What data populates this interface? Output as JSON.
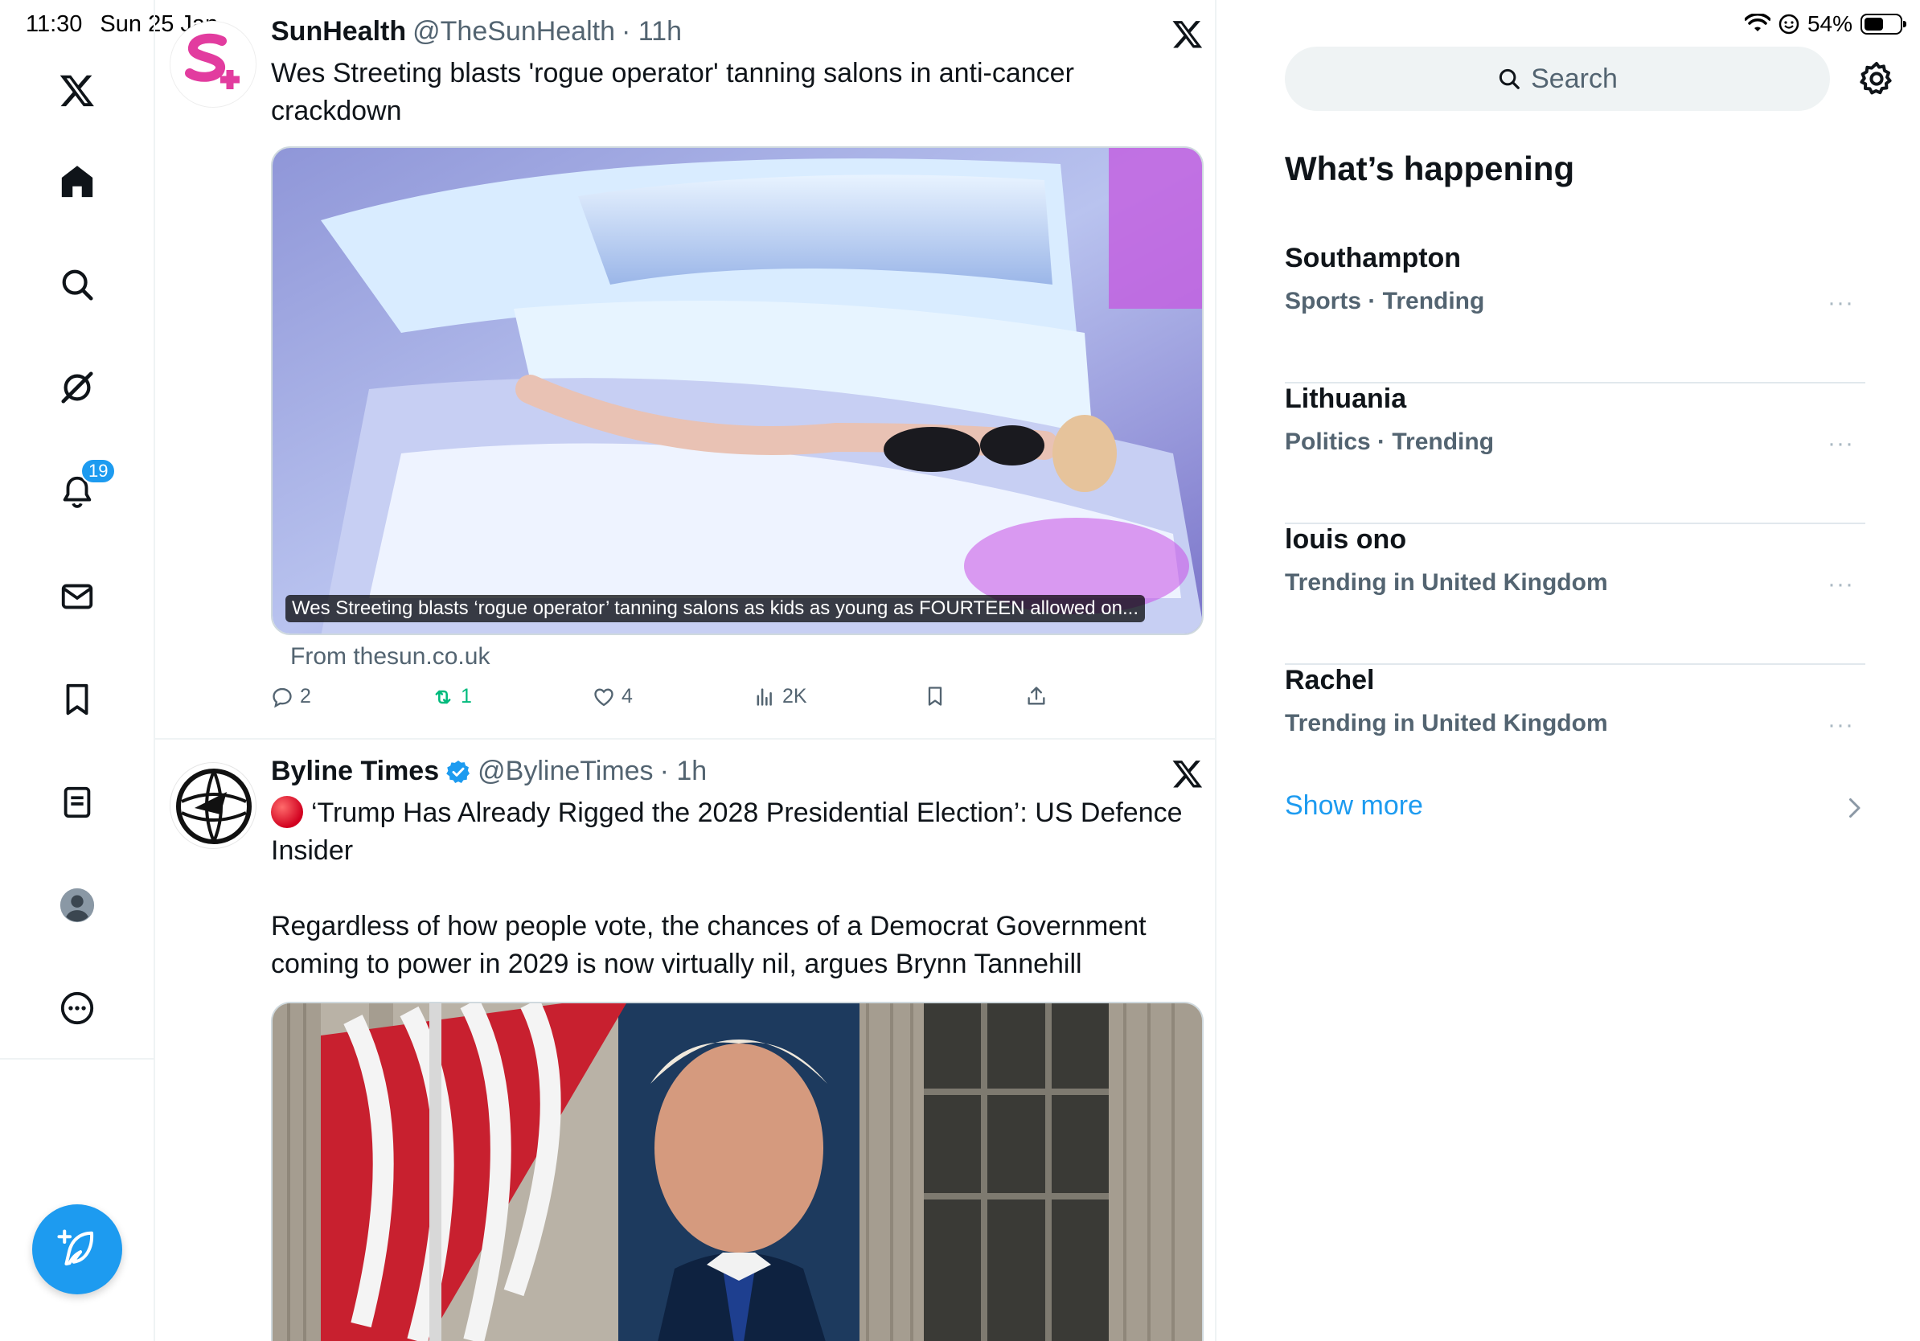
{
  "status_bar": {
    "time": "11:30",
    "date": "Sun 25 Jan",
    "battery": "54%",
    "battery_level": 0.54
  },
  "nav": {
    "notifications_badge": "19",
    "items": [
      "x-logo-icon",
      "home-icon",
      "search-icon",
      "grok-icon",
      "notifications-icon",
      "messages-icon",
      "bookmarks-icon",
      "lists-icon",
      "profile-icon",
      "more-icon"
    ]
  },
  "feed": {
    "tweets": [
      {
        "name": "SunHealth",
        "handle": "@TheSunHealth",
        "time": "· 11h",
        "text": "Wes Streeting blasts 'rogue operator' tanning salons in anti-cancer crackdown",
        "media_caption": "Wes Streeting blasts ‘rogue operator’ tanning salons as kids as young as FOURTEEN allowed on...",
        "link_source": "From thesun.co.uk",
        "replies": "2",
        "reposts": "1",
        "likes": "4",
        "views": "2K"
      },
      {
        "name": "Byline Times",
        "handle": "@BylineTimes",
        "time": "· 1h",
        "text": "‘Trump Has Already Rigged the 2028 Presidential Election’: US Defence Insider\n\nRegardless of how people vote, the chances of a Democrat Government coming to power in 2029 is now virtually nil, argues Brynn Tannehill"
      }
    ]
  },
  "sidebar": {
    "search_placeholder": "Search",
    "title": "What’s happening",
    "trends": [
      {
        "name": "Southampton",
        "category": "Sports · Trending"
      },
      {
        "name": "Lithuania",
        "category": "Politics · Trending"
      },
      {
        "name": "louis ono",
        "category": "Trending in United Kingdom"
      },
      {
        "name": "Rachel",
        "category": "Trending in United Kingdom"
      }
    ],
    "more_glyph": "···",
    "show_more": "Show more"
  },
  "colors": {
    "accent": "#1d9bf0",
    "text_primary": "#0f1419",
    "text_secondary": "#536471",
    "repost_green": "#00ba7c",
    "border": "#eff3f4"
  }
}
